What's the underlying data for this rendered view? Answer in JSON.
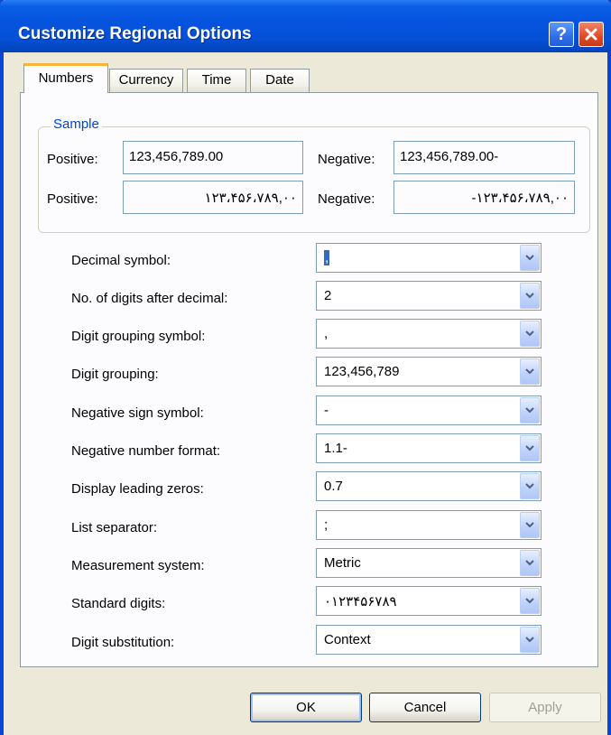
{
  "window": {
    "title": "Customize Regional Options"
  },
  "titlebar": {
    "help_label": "?"
  },
  "tabs": [
    {
      "label": "Numbers"
    },
    {
      "label": "Currency"
    },
    {
      "label": "Time"
    },
    {
      "label": "Date"
    }
  ],
  "sample": {
    "group_label": "Sample",
    "positive_label": "Positive:",
    "negative_label": "Negative:",
    "positive_value": "123,456,789.00",
    "negative_value": "123,456,789.00-",
    "positive_native": "۱۲۳،۴۵۶،۷۸۹,۰۰",
    "negative_native": "-۱۲۳،۴۵۶،۷۸۹,۰۰"
  },
  "settings": [
    {
      "label": "Decimal symbol:",
      "value": ","
    },
    {
      "label": "No. of digits after decimal:",
      "value": "2"
    },
    {
      "label": "Digit grouping symbol:",
      "value": ","
    },
    {
      "label": "Digit grouping:",
      "value": "123,456,789"
    },
    {
      "label": "Negative sign symbol:",
      "value": "-"
    },
    {
      "label": "Negative number format:",
      "value": "1.1-"
    },
    {
      "label": "Display leading zeros:",
      "value": "0.7"
    },
    {
      "label": "List separator:",
      "value": ";"
    },
    {
      "label": "Measurement system:",
      "value": "Metric"
    },
    {
      "label": "Standard digits:",
      "value": "۰۱۲۳۴۵۶۷۸۹"
    },
    {
      "label": "Digit substitution:",
      "value": "Context"
    }
  ],
  "buttons": {
    "ok": "OK",
    "cancel": "Cancel",
    "apply": "Apply"
  },
  "colors": {
    "title_bar": "#0653df",
    "close_button": "#e04a24",
    "active_tab_accent": "#f8b33a",
    "group_label": "#0046d5"
  },
  "icons": {
    "help": "question-icon",
    "close": "close-icon",
    "dropdown": "chevron-down-icon"
  }
}
